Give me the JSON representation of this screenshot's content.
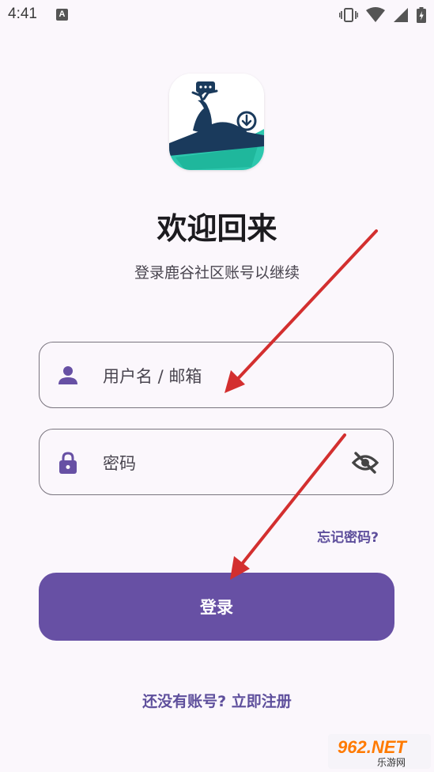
{
  "status_bar": {
    "time": "4:41",
    "notification_icon": "A",
    "icons": [
      "vibrate-icon",
      "wifi-icon",
      "signal-icon",
      "battery-charging-icon"
    ]
  },
  "app": {
    "logo_icon": "deer-logo-icon",
    "title": "欢迎回来",
    "subtitle": "登录鹿谷社区账号以继续"
  },
  "form": {
    "username_placeholder": "用户名 / 邮箱",
    "password_placeholder": "密码",
    "forgot_label": "忘记密码?",
    "login_label": "登录",
    "register_label": "还没有账号? 立即注册"
  },
  "watermark": {
    "brand": "962.NET",
    "tagline": "乐游网"
  },
  "colors": {
    "primary": "#6750a4",
    "link": "#5e4f9c",
    "background": "#fbf7fc",
    "annotation_arrow": "#d32f2f"
  }
}
